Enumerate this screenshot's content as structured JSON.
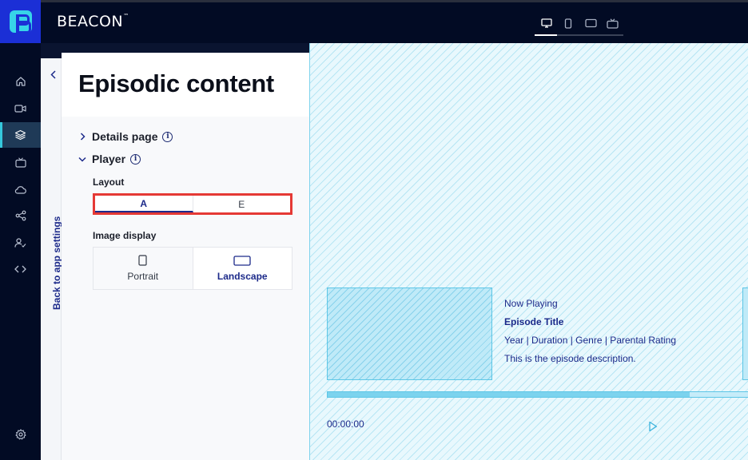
{
  "app": {
    "brand": "BEACON",
    "brand_mark": "™"
  },
  "topbar": {
    "devices": [
      {
        "icon": "desktop-icon",
        "active": true
      },
      {
        "icon": "mobile-icon",
        "active": false
      },
      {
        "icon": "tablet-icon",
        "active": false
      },
      {
        "icon": "tv-icon",
        "active": false
      }
    ]
  },
  "sidebar": {
    "items": [
      {
        "icon": "home-icon"
      },
      {
        "icon": "video-icon"
      },
      {
        "icon": "layers-icon",
        "active": true
      },
      {
        "icon": "tv-icon"
      },
      {
        "icon": "cloud-icon"
      },
      {
        "icon": "share-icon"
      },
      {
        "icon": "user-check-icon"
      },
      {
        "icon": "code-icon"
      },
      {
        "icon": "gear-icon"
      }
    ]
  },
  "back": {
    "label": "Back to app settings"
  },
  "panel": {
    "title": "Episodic content",
    "sections": {
      "details": "Details page",
      "player": "Player"
    },
    "layout": {
      "label": "Layout",
      "options": [
        "A",
        "E"
      ],
      "selected": "A"
    },
    "image_display": {
      "label": "Image display",
      "options": [
        "Portrait",
        "Landscape"
      ],
      "selected": "Landscape"
    }
  },
  "preview": {
    "now_playing": "Now Playing",
    "episode_title": "Episode Title",
    "meta": "Year | Duration | Genre | Parental Rating",
    "description": "This is the episode description.",
    "time": "00:00:00",
    "progress": 0.86,
    "colors": {
      "accent": "#1c2a8a",
      "preview_bg": "#e8f8fd",
      "preview_line": "#5dc6e6",
      "highlight": "#e53935"
    }
  }
}
